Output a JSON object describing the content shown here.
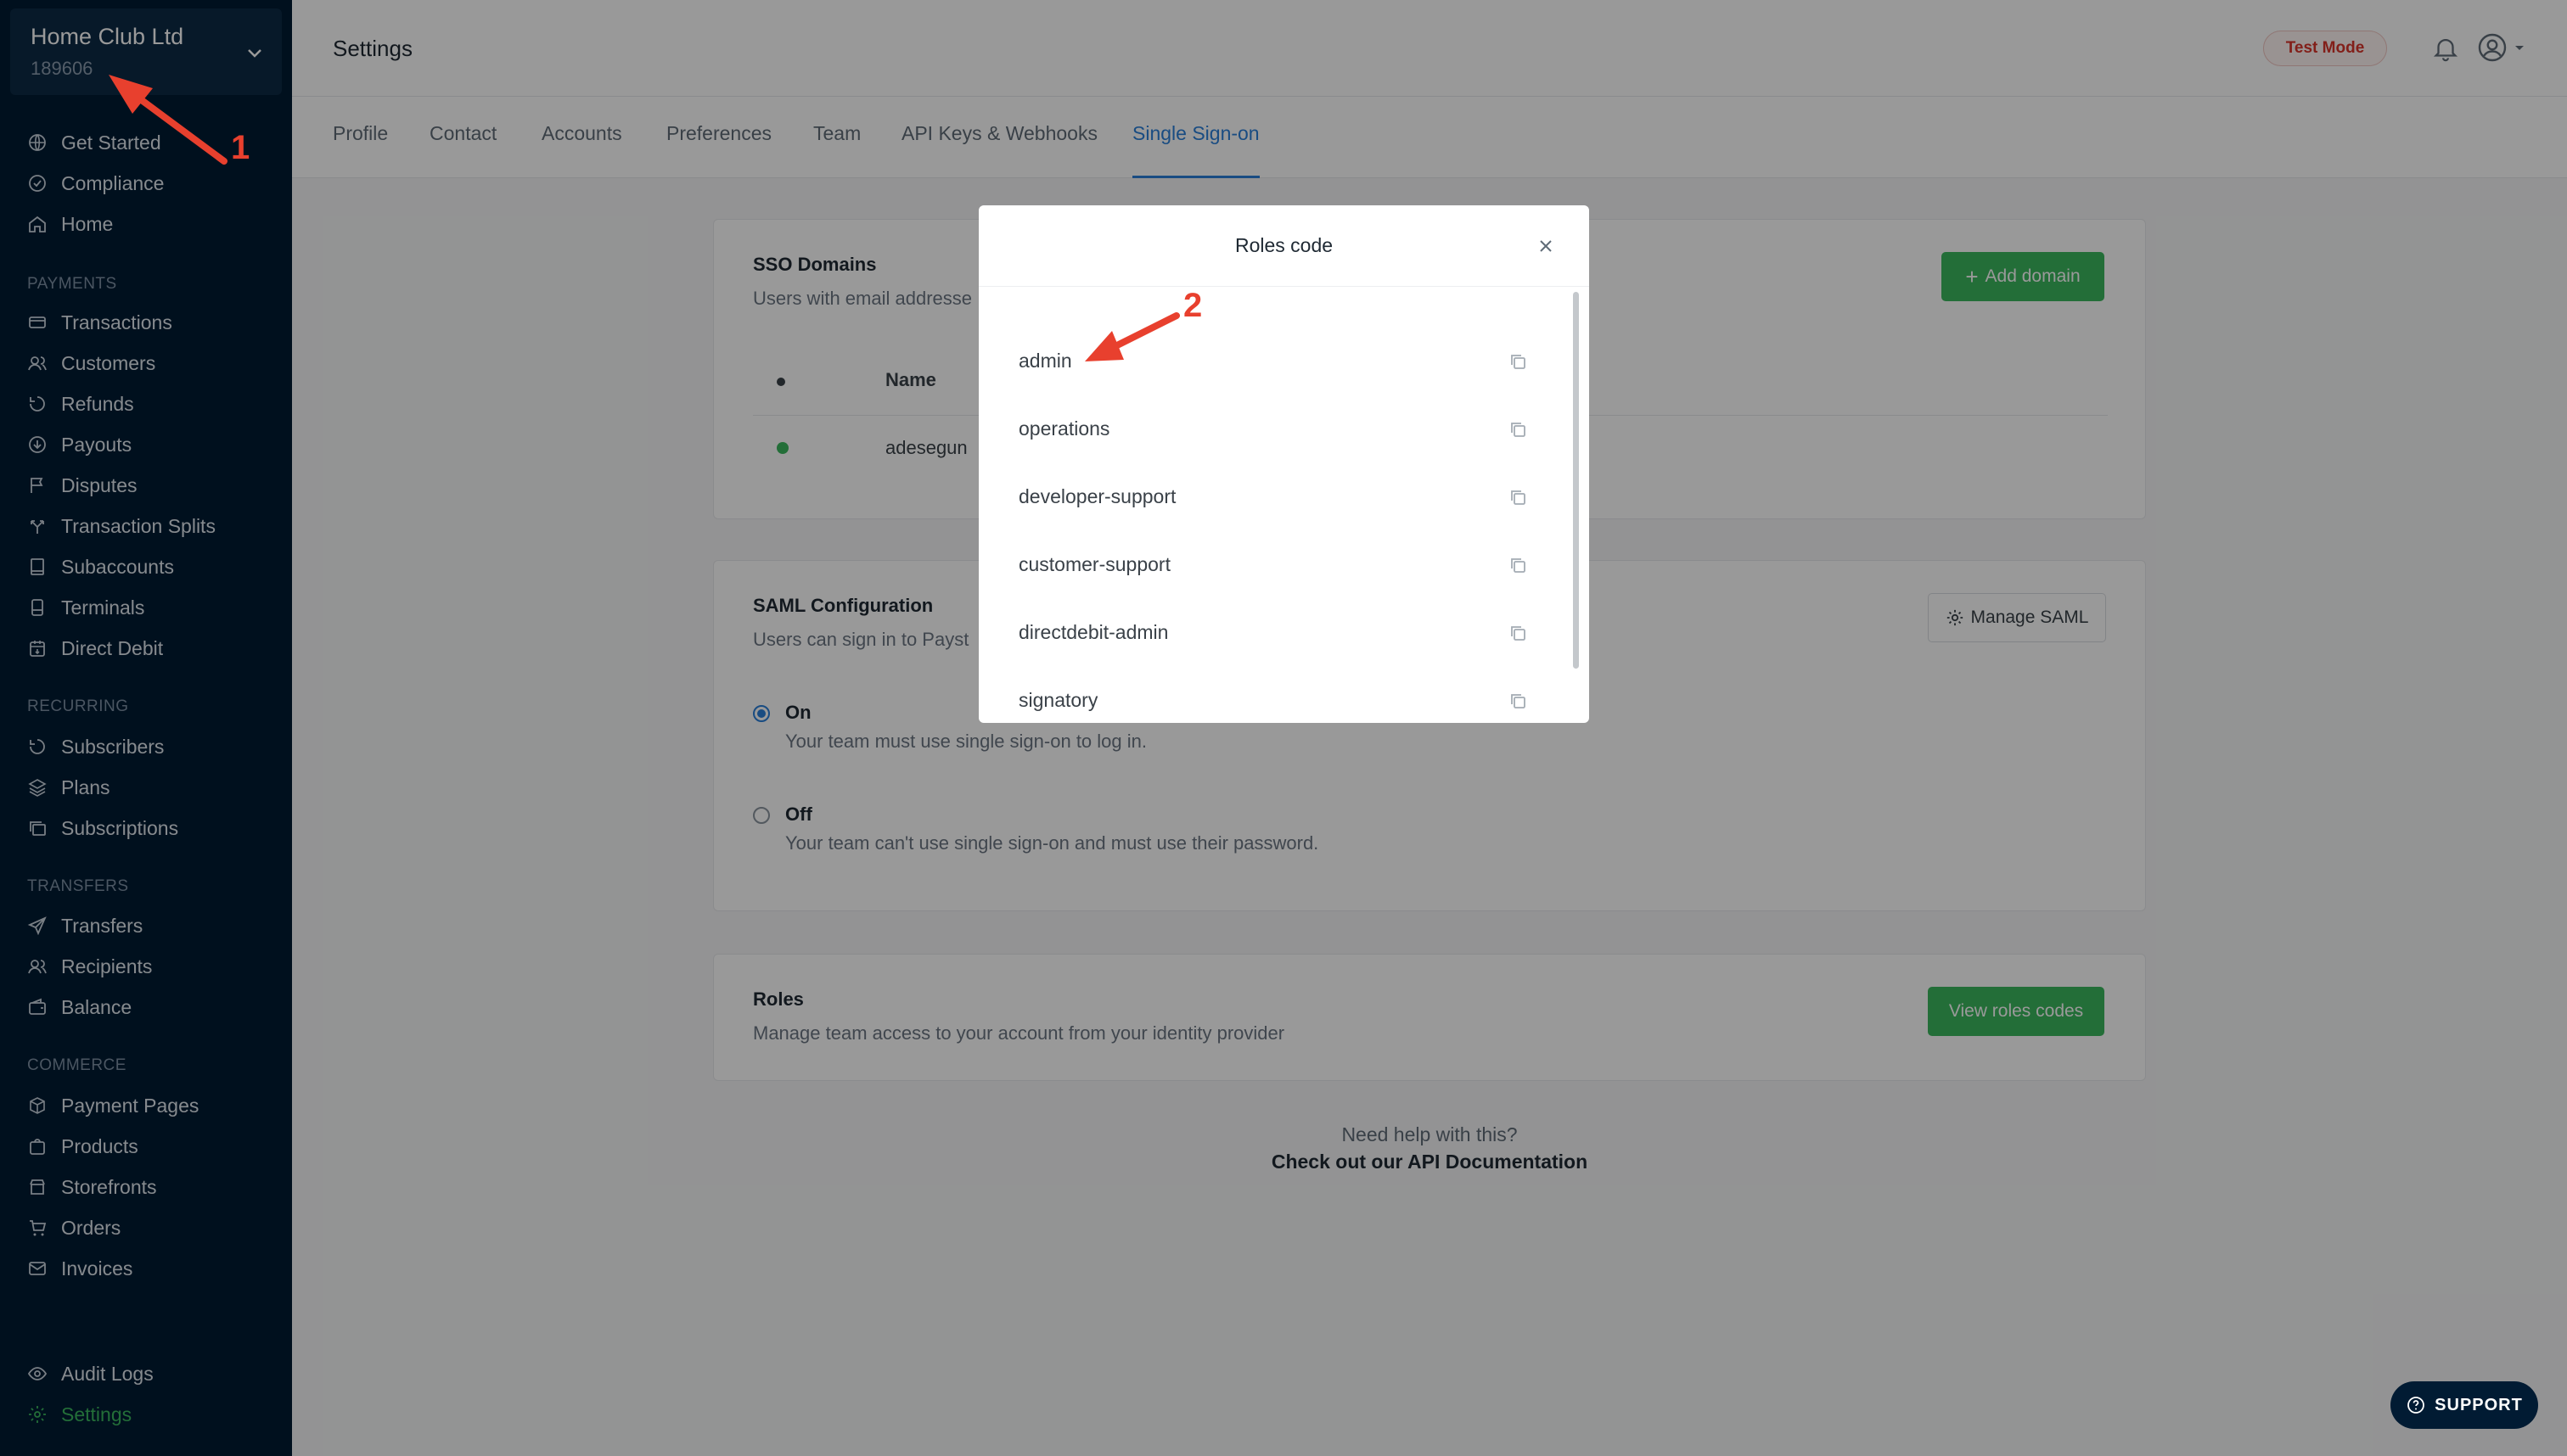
{
  "sidebar": {
    "business_name": "Home Club Ltd",
    "business_id": "189606",
    "top_items": [
      {
        "label": "Get Started",
        "icon": "globe-icon"
      },
      {
        "label": "Compliance",
        "icon": "check-circle-icon"
      },
      {
        "label": "Home",
        "icon": "home-icon"
      }
    ],
    "sections": [
      {
        "title": "PAYMENTS",
        "items": [
          {
            "label": "Transactions",
            "icon": "card-icon"
          },
          {
            "label": "Customers",
            "icon": "users-icon"
          },
          {
            "label": "Refunds",
            "icon": "refund-icon"
          },
          {
            "label": "Payouts",
            "icon": "payout-icon"
          },
          {
            "label": "Disputes",
            "icon": "flag-icon"
          },
          {
            "label": "Transaction Splits",
            "icon": "split-icon"
          },
          {
            "label": "Subaccounts",
            "icon": "book-icon"
          },
          {
            "label": "Terminals",
            "icon": "terminal-icon"
          },
          {
            "label": "Direct Debit",
            "icon": "calendar-icon"
          }
        ]
      },
      {
        "title": "RECURRING",
        "items": [
          {
            "label": "Subscribers",
            "icon": "refresh-icon"
          },
          {
            "label": "Plans",
            "icon": "layers-icon"
          },
          {
            "label": "Subscriptions",
            "icon": "stack-icon"
          }
        ]
      },
      {
        "title": "TRANSFERS",
        "items": [
          {
            "label": "Transfers",
            "icon": "send-icon"
          },
          {
            "label": "Recipients",
            "icon": "users-icon"
          },
          {
            "label": "Balance",
            "icon": "wallet-icon"
          }
        ]
      },
      {
        "title": "COMMERCE",
        "items": [
          {
            "label": "Payment Pages",
            "icon": "box-icon"
          },
          {
            "label": "Products",
            "icon": "bag-icon"
          },
          {
            "label": "Storefronts",
            "icon": "store-icon"
          },
          {
            "label": "Orders",
            "icon": "cart-icon"
          },
          {
            "label": "Invoices",
            "icon": "mail-icon"
          }
        ]
      }
    ],
    "bottom_items": [
      {
        "label": "Audit Logs",
        "icon": "eye-icon"
      },
      {
        "label": "Settings",
        "icon": "gear-icon",
        "active": true
      }
    ]
  },
  "header": {
    "title": "Settings",
    "test_mode_label": "Test Mode"
  },
  "tabs": [
    {
      "label": "Profile"
    },
    {
      "label": "Contact"
    },
    {
      "label": "Accounts"
    },
    {
      "label": "Preferences"
    },
    {
      "label": "Team"
    },
    {
      "label": "API Keys & Webhooks"
    },
    {
      "label": "Single Sign-on",
      "active": true
    }
  ],
  "sso_domains": {
    "title": "SSO Domains",
    "subtitle": "Users with email addresse",
    "add_button": "Add domain",
    "table_header_name": "Name",
    "row_name": "adesegun"
  },
  "saml": {
    "title": "SAML Configuration",
    "subtitle": "Users can sign in to Payst",
    "manage_button": "Manage SAML",
    "on_label": "On",
    "on_desc": "Your team must use single sign-on to log in.",
    "off_label": "Off",
    "off_desc": "Your team can't use single sign-on and must use their password.",
    "selected": "On"
  },
  "roles": {
    "title": "Roles",
    "subtitle": "Manage team access to your account from your identity provider",
    "view_button": "View roles codes"
  },
  "help": {
    "line1": "Need help with this?",
    "line2": "Check out our API Documentation"
  },
  "support_label": "SUPPORT",
  "modal": {
    "title": "Roles code",
    "roles": [
      "admin",
      "operations",
      "developer-support",
      "customer-support",
      "directdebit-admin",
      "signatory"
    ]
  },
  "annotations": {
    "label_1": "1",
    "label_2": "2",
    "color": "#e8402e"
  },
  "colors": {
    "sidebar_bg": "#011b33",
    "accent_green": "#3bb75e",
    "tab_active": "#2b7fd9",
    "test_mode": "#d9342b"
  }
}
